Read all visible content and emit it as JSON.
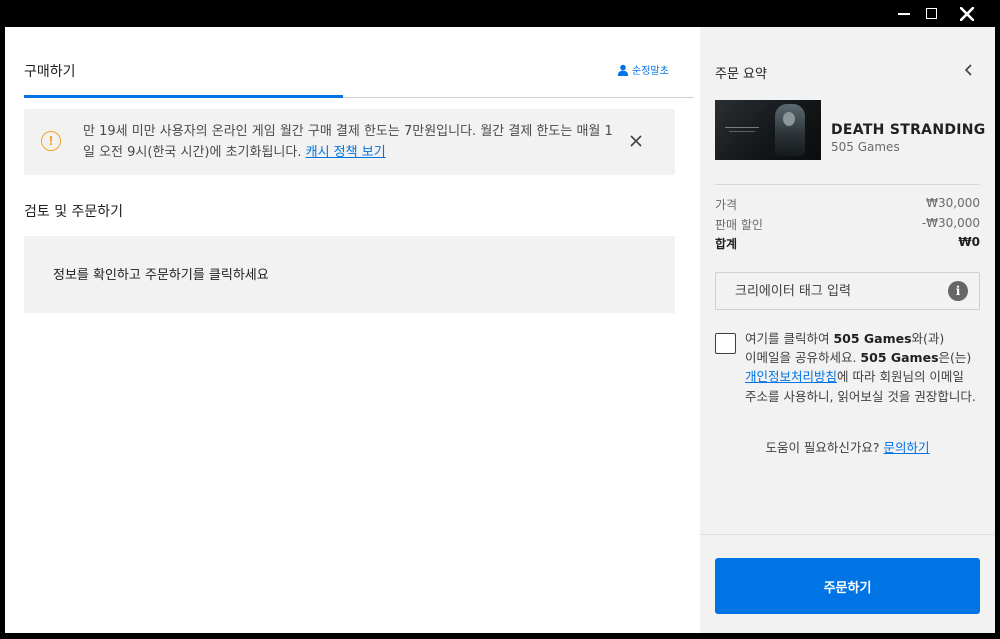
{
  "window": {
    "controls": [
      "minimize-icon",
      "maximize-icon",
      "close-icon"
    ]
  },
  "left": {
    "tab_label": "구매하기",
    "sign_out_label": "순정말초",
    "notice": {
      "icon": "warning-circle-icon",
      "text": "만 19세 미만 사용자의 온라인 게임 월간 구매 결제 한도는 7만원입니다. 월간 결제 한도는 매월 1일 오전 9시(한국 시간)에 초기화됩니다.",
      "link": "캐시 정책 보기"
    },
    "section_title": "검토 및 주문하기",
    "info_message": "정보를 확인하고 주문하기를 클릭하세요"
  },
  "right": {
    "summary_title": "주문 요약",
    "product": {
      "title": "DEATH STRANDING",
      "publisher": "505 Games"
    },
    "prices": {
      "price_label": "가격",
      "price_value": "₩30,000",
      "discount_label": "판매 할인",
      "discount_value": "-₩30,000",
      "total_label": "합계",
      "total_value": "₩0"
    },
    "creator_tag_placeholder": "크리에이터 태그 입력",
    "consent": {
      "p1": "여기를 클릭하여 ",
      "b1": "505 Games",
      "p2": "와(과) 이메일을 공유하세요. ",
      "b2": "505 Games",
      "p3": "은(는) ",
      "link": "개인정보처리방침",
      "p4": "에 따라 회원님의 이메일 주소를 사용하니, 읽어보실 것을 권장합니다."
    },
    "help_text": "도움이 필요하신가요? ",
    "help_link": "문의하기",
    "order_button": "주문하기"
  },
  "colors": {
    "accent": "#0074e4",
    "warning": "#f5a623",
    "panel_bg": "#f2f2f2"
  }
}
